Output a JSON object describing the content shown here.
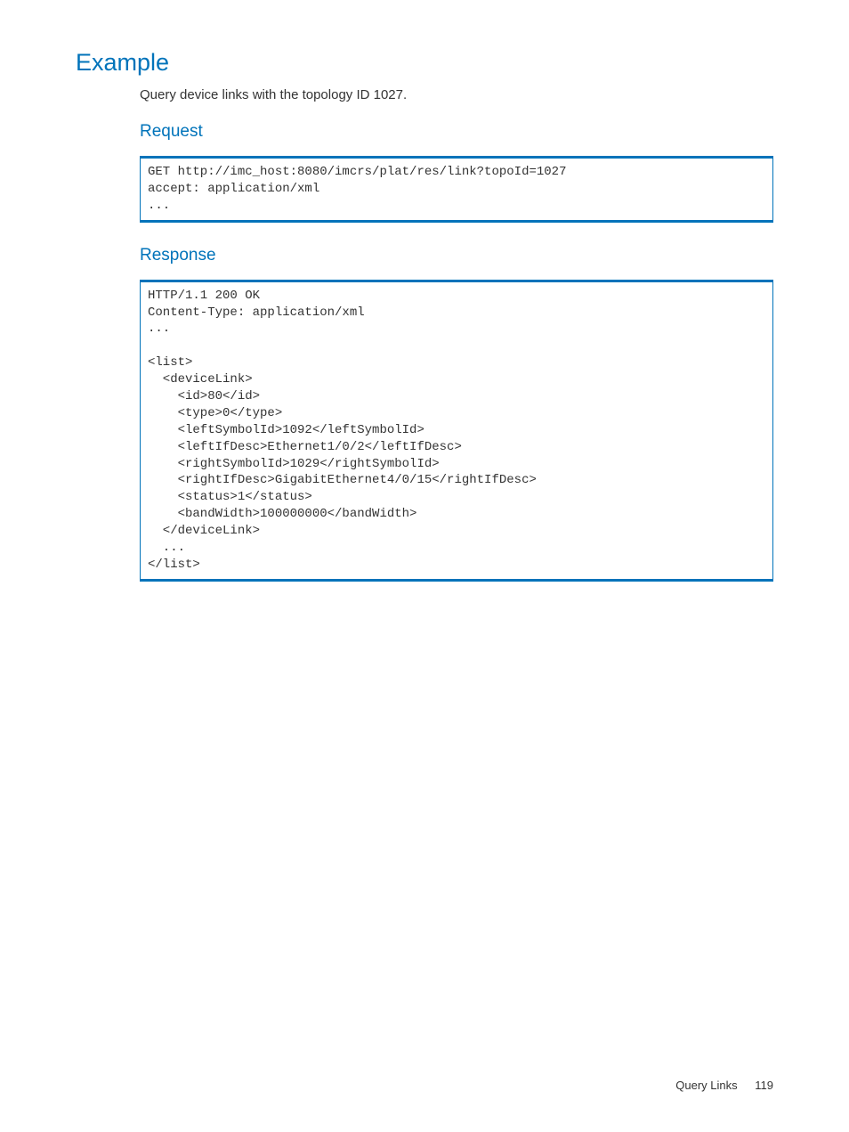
{
  "headings": {
    "example": "Example",
    "request": "Request",
    "response": "Response"
  },
  "description": "Query device links with the topology ID 1027.",
  "code": {
    "request": "GET http://imc_host:8080/imcrs/plat/res/link?topoId=1027\naccept: application/xml\n...",
    "response": "HTTP/1.1 200 OK\nContent-Type: application/xml\n...\n\n<list>\n  <deviceLink>\n    <id>80</id>\n    <type>0</type>\n    <leftSymbolId>1092</leftSymbolId>\n    <leftIfDesc>Ethernet1/0/2</leftIfDesc>\n    <rightSymbolId>1029</rightSymbolId>\n    <rightIfDesc>GigabitEthernet4/0/15</rightIfDesc>\n    <status>1</status>\n    <bandWidth>100000000</bandWidth>\n  </deviceLink>\n  ...\n</list>"
  },
  "footer": {
    "section": "Query Links",
    "page": "119"
  }
}
